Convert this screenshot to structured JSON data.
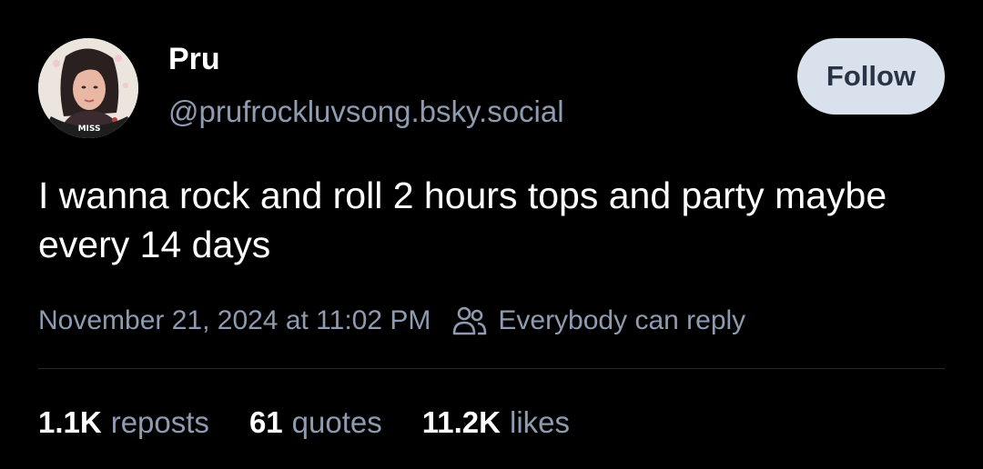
{
  "author": {
    "name": "Pru",
    "handle": "@prufrockluvsong.bsky.social"
  },
  "follow_label": "Follow",
  "post": {
    "text": "I wanna rock and roll 2 hours tops and party maybe every 14 days",
    "timestamp": "November 21, 2024 at 11:02 PM",
    "reply_setting": "Everybody can reply"
  },
  "stats": [
    {
      "count": "1.1K",
      "label": "reposts"
    },
    {
      "count": "61",
      "label": "quotes"
    },
    {
      "count": "11.2K",
      "label": "likes"
    }
  ],
  "avatar_badge": "MISS",
  "icons": {
    "reply_setting": "people-icon"
  }
}
